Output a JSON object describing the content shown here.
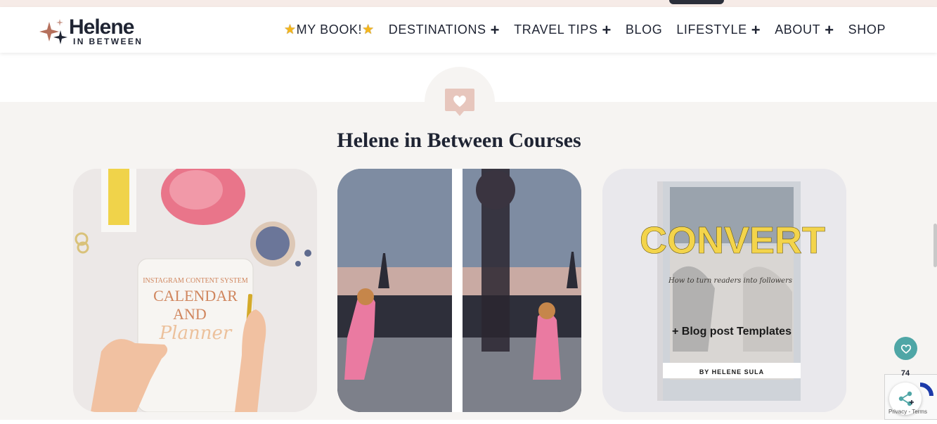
{
  "brand": {
    "title": "Helene",
    "subtitle": "IN BETWEEN"
  },
  "nav": {
    "items": [
      {
        "label": "MY BOOK!",
        "stars": true,
        "submenu": false
      },
      {
        "label": "DESTINATIONS",
        "stars": false,
        "submenu": true
      },
      {
        "label": "TRAVEL TIPS",
        "stars": false,
        "submenu": true
      },
      {
        "label": "BLOG",
        "stars": false,
        "submenu": false
      },
      {
        "label": "LIFESTYLE",
        "stars": false,
        "submenu": true
      },
      {
        "label": "ABOUT",
        "stars": false,
        "submenu": true
      },
      {
        "label": "SHOP",
        "stars": false,
        "submenu": false
      }
    ]
  },
  "section": {
    "title": "Helene in Between Courses",
    "icon": "heart-chat-icon"
  },
  "cards": [
    {
      "name": "instagram-planner-card",
      "kicker": "INSTAGRAM CONTENT SYSTEM",
      "line1": "CALENDAR",
      "line2": "AND",
      "script": "Planner"
    },
    {
      "name": "paris-photo-card"
    },
    {
      "name": "convert-book-card",
      "title": "CONVERT",
      "subtitle": "How to turn readers into followers",
      "extra": "+ Blog post Templates",
      "author": "BY HELENE SULA"
    }
  ],
  "floating": {
    "share_count": "74",
    "recaptcha_text": "Privacy - Terms"
  },
  "colors": {
    "accent": "#4fa6a6",
    "section_bg": "#f6f4f2",
    "heart_icon": "#e7c6bd",
    "text": "#1f2433"
  }
}
